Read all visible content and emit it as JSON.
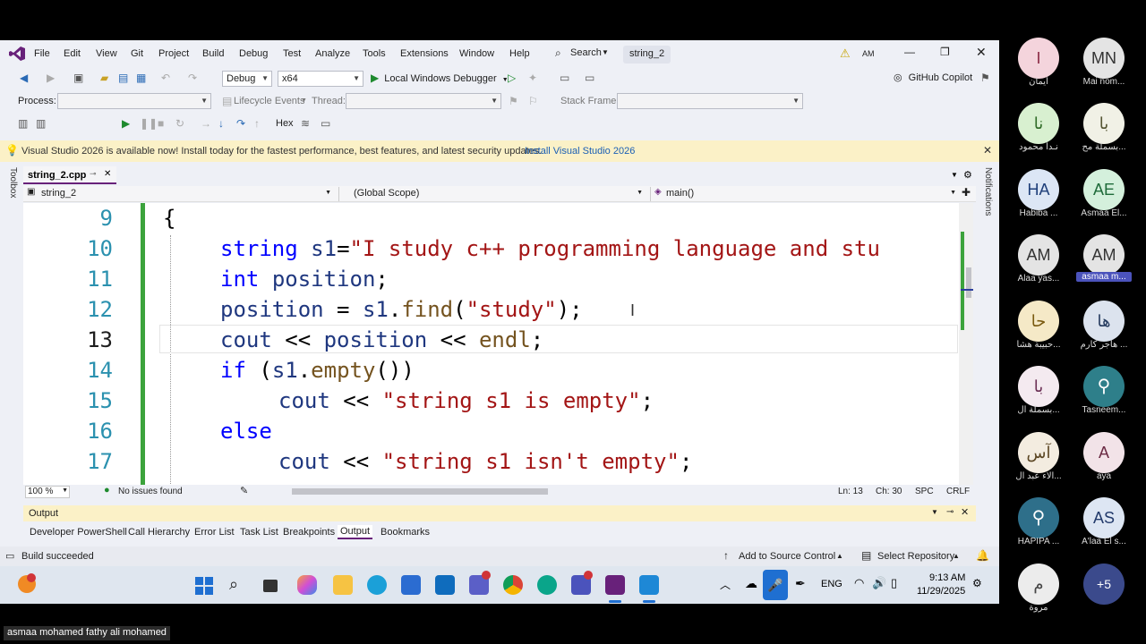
{
  "menu": {
    "items": [
      "File",
      "Edit",
      "View",
      "Git",
      "Project",
      "Build",
      "Debug",
      "Test",
      "Analyze",
      "Tools",
      "Extensions",
      "Window",
      "Help"
    ],
    "search": "Search",
    "solution_name": "string_2",
    "user_initials": "AM",
    "copilot": "GitHub Copilot"
  },
  "toolbar": {
    "config": "Debug",
    "platform": "x64",
    "run_label": "Local Windows Debugger",
    "process_label": "Process:",
    "lifecycle_label": "Lifecycle Events",
    "thread_label": "Thread:",
    "stackframe_label": "Stack Frame:",
    "hex_label": "Hex"
  },
  "banner": {
    "message": "Visual Studio 2026 is available now! Install today for the fastest performance, best features, and latest security updates.",
    "link": "Install Visual Studio 2026"
  },
  "editor": {
    "tab": "string_2.cpp",
    "nav_project": "string_2",
    "nav_scope": "(Global Scope)",
    "nav_member": "main()",
    "zoom": "100 %",
    "issues": "No issues found",
    "position": "Ln: 13",
    "column": "Ch: 30",
    "whitespace": "SPC",
    "line_ending": "CRLF",
    "lines": [
      {
        "num": "9",
        "text": "{"
      },
      {
        "num": "10",
        "text": "string s1=\"I study c++ programming language and stu"
      },
      {
        "num": "11",
        "text": "int position;"
      },
      {
        "num": "12",
        "text": "position = s1.find(\"study\");"
      },
      {
        "num": "13",
        "text": "cout << position << endl;"
      },
      {
        "num": "14",
        "text": "if (s1.empty())"
      },
      {
        "num": "15",
        "text": "cout << \"string s1 is empty\";"
      },
      {
        "num": "16",
        "text": "else"
      },
      {
        "num": "17",
        "text": "cout << \"string s1 isn't empty\";"
      }
    ]
  },
  "output": {
    "title": "Output",
    "tabs": [
      "Developer PowerShell",
      "Call Hierarchy",
      "Error List",
      "Task List",
      "Breakpoints",
      "Output",
      "Bookmarks"
    ],
    "active_tab": "Output"
  },
  "statusbar": {
    "message": "Build succeeded",
    "source_control": "Add to Source Control",
    "repository": "Select Repository"
  },
  "side_labels": {
    "toolbox": "Toolbox",
    "notifications": "Notifications"
  },
  "taskbar": {
    "language": "ENG",
    "time": "9:13 AM",
    "date": "11/29/2025"
  },
  "participants": [
    {
      "initials": "I",
      "name": "ايمان",
      "bg": "#f4d4dc",
      "fg": "#8a2a44"
    },
    {
      "initials": "MN",
      "name": "Mai nom...",
      "bg": "#e4e4e4",
      "fg": "#333333"
    },
    {
      "initials": "نا",
      "name": "نـدا محمود",
      "bg": "#d8f0d0",
      "fg": "#2f6b27"
    },
    {
      "initials": "با",
      "name": "بسملة مح...",
      "bg": "#f1f1e6",
      "fg": "#555533"
    },
    {
      "initials": "HA",
      "name": "Habiba ...",
      "bg": "#dce6f5",
      "fg": "#1f3f7a"
    },
    {
      "initials": "AE",
      "name": "Asmaa El...",
      "bg": "#d4f0dc",
      "fg": "#1f6b3a"
    },
    {
      "initials": "AM",
      "name": "Alaa yas...",
      "bg": "#e4e4e4",
      "fg": "#333333"
    },
    {
      "initials": "AM",
      "name": "asmaa m...",
      "bg": "#e4e4e4",
      "fg": "#333333"
    },
    {
      "initials": "حا",
      "name": "حبيبة هشا...",
      "bg": "#f5e9c7",
      "fg": "#7a5a10"
    },
    {
      "initials": "ها",
      "name": "هاجر كارم ...",
      "bg": "#dce3ee",
      "fg": "#243a5e"
    },
    {
      "initials": "با",
      "name": "بسملة ال...",
      "bg": "#f4eaf0",
      "fg": "#6b2f55"
    },
    {
      "initials": "",
      "name": "Tasneem...",
      "bg": "#2e7f8a",
      "fg": "#ffffff"
    },
    {
      "initials": "آس",
      "name": "آلاء عبد ال...",
      "bg": "#f3ece0",
      "fg": "#5a4522"
    },
    {
      "initials": "A",
      "name": "aya",
      "bg": "#f2e3e8",
      "fg": "#6b2b44"
    },
    {
      "initials": "",
      "name": "HAPIPA ...",
      "bg": "#2e6f8a",
      "fg": "#ffffff"
    },
    {
      "initials": "AS",
      "name": "A'laa El s...",
      "bg": "#dde6f3",
      "fg": "#223a6b"
    },
    {
      "initials": "م",
      "name": "مروة",
      "bg": "#ececec",
      "fg": "#444444"
    },
    {
      "initials": "+5",
      "name": "",
      "bg": "#3b4a8c",
      "fg": "#ffffff"
    }
  ],
  "caption": "asmaa mohamed fathy ali mohamed",
  "colors": {
    "vs_purple": "#68217a",
    "keyword": "#0000ff",
    "string": "#a31515",
    "line_number": "#2b91af",
    "change_bar": "#3ca33c"
  }
}
